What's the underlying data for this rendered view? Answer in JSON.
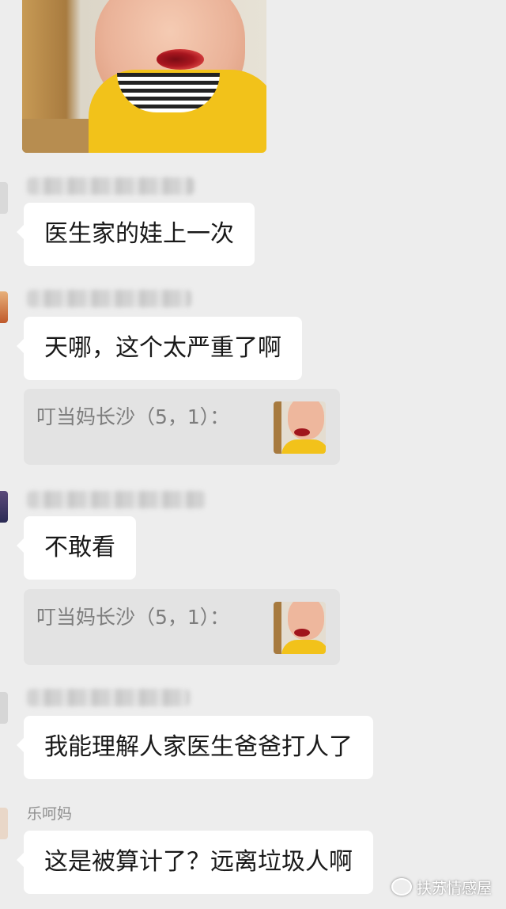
{
  "messages": [
    {
      "sender": "",
      "text": "医生家的娃上一次"
    },
    {
      "sender": "",
      "text": "天哪，这个太严重了啊",
      "quote": {
        "text": "叮当妈长沙（5，1）："
      }
    },
    {
      "sender": "",
      "text": "不敢看",
      "quote": {
        "text": "叮当妈长沙（5，1）："
      }
    },
    {
      "sender": "",
      "text": "我能理解人家医生爸爸打人了"
    },
    {
      "sender": "乐呵妈",
      "text": "这是被算计了？远离垃圾人啊"
    }
  ],
  "watermark": {
    "text": "扶苏情感屋",
    "icon": "wechat-official-icon"
  },
  "colors": {
    "background": "#ededed",
    "bubble": "#ffffff",
    "quote_bg": "#e3e3e3",
    "quote_text": "#7d7d7d"
  }
}
